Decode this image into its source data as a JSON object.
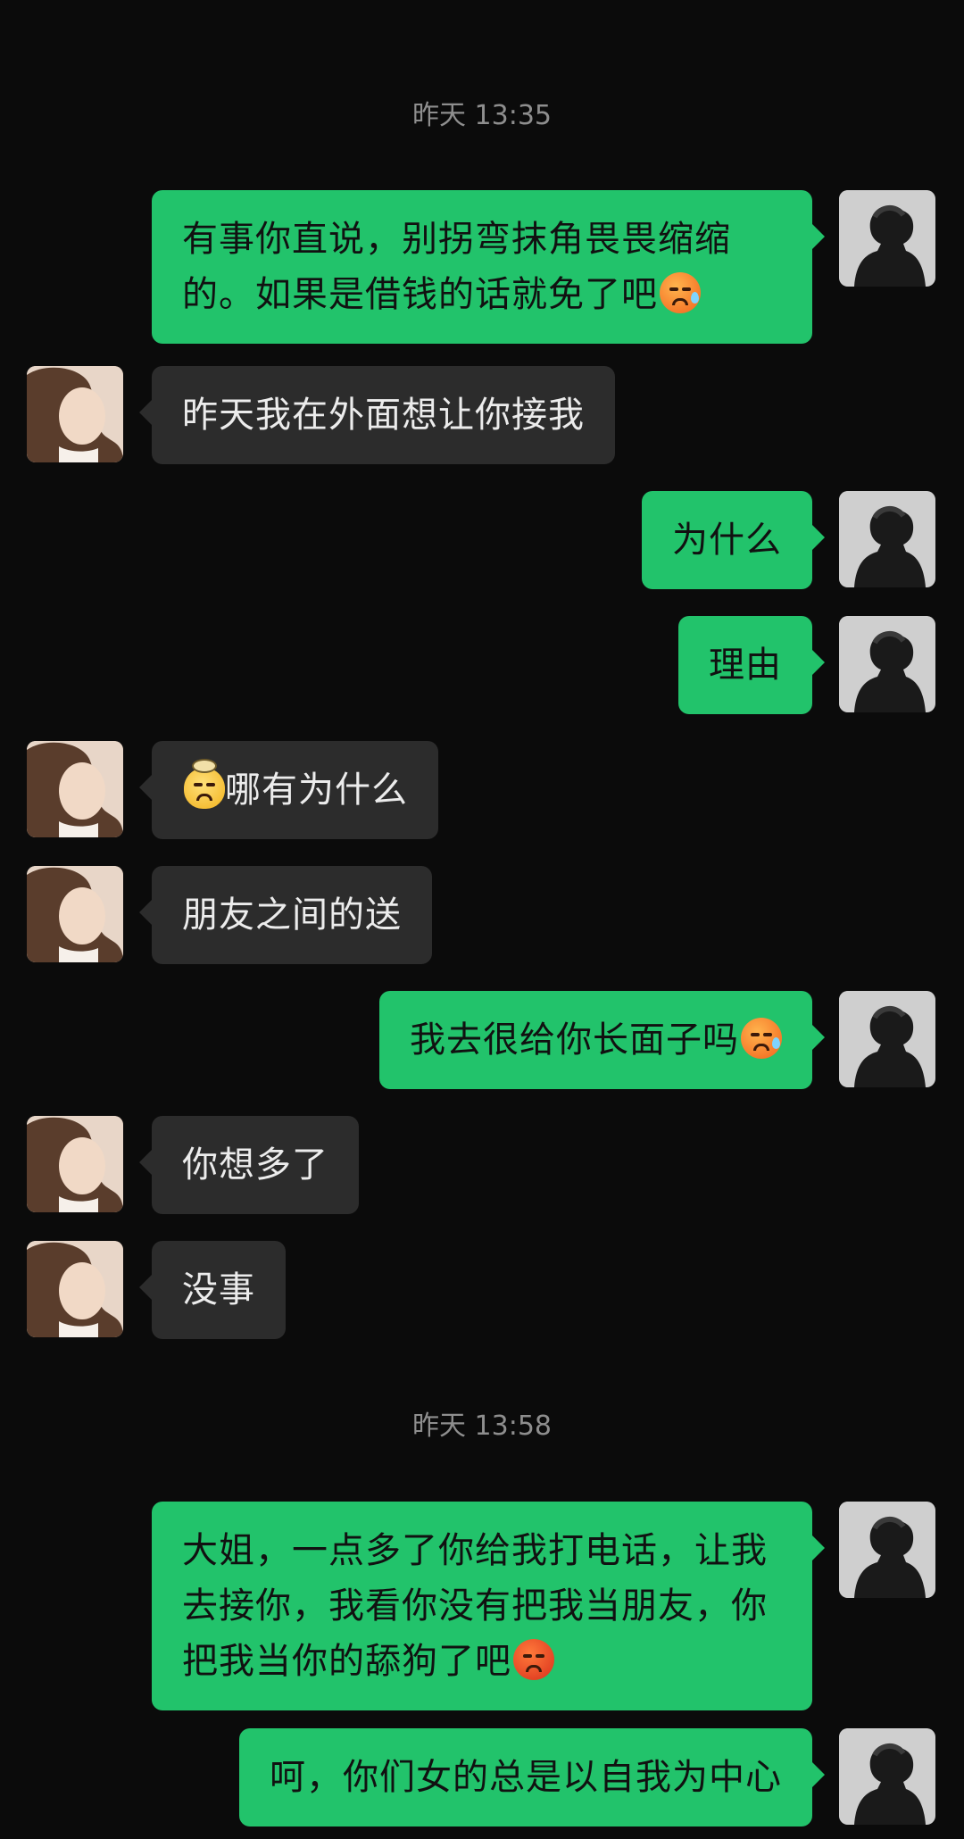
{
  "timestamps": [
    "昨天 13:35",
    "昨天 13:58"
  ],
  "messages": [
    {
      "side": "out",
      "text": "有事你直说，别拐弯抹角畏畏缩缩的。如果是借钱的话就免了吧",
      "emoji": "sweat-face-icon"
    },
    {
      "side": "in",
      "text": "昨天我在外面想让你接我"
    },
    {
      "side": "out",
      "text": "为什么"
    },
    {
      "side": "out",
      "text": "理由"
    },
    {
      "side": "in",
      "text": "哪有为什么",
      "emoji_before": "annoyed-face-icon"
    },
    {
      "side": "in",
      "text": "朋友之间的送"
    },
    {
      "side": "out",
      "text": "我去很给你长面子吗",
      "emoji": "sweat-face-icon"
    },
    {
      "side": "in",
      "text": "你想多了"
    },
    {
      "side": "in",
      "text": "没事"
    },
    {
      "side": "out",
      "text": "大姐，一点多了你给我打电话，让我去接你，我看你没有把我当朋友，你把我当你的舔狗了吧",
      "emoji": "angry-face-icon"
    },
    {
      "side": "out",
      "text": "呵，你们女的总是以自我为中心"
    }
  ],
  "colors": {
    "background": "#0b0b0b",
    "outgoing_bubble": "#22c36b",
    "incoming_bubble": "#2c2c2c",
    "timestamp": "#8e8e8e"
  }
}
